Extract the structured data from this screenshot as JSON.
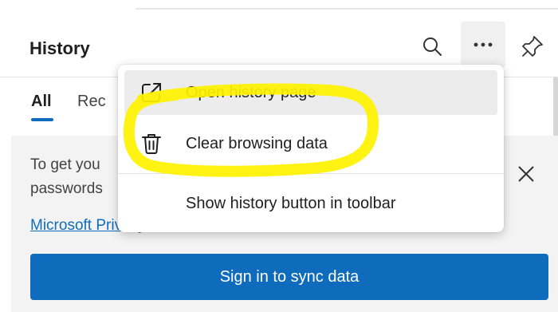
{
  "panel": {
    "title": "History",
    "tabs": [
      {
        "label": "All",
        "selected": true
      },
      {
        "label": "Rec",
        "selected": false
      }
    ]
  },
  "header_icons": [
    "search-icon",
    "more-icon",
    "pin-icon"
  ],
  "banner": {
    "text_line1": "To get you",
    "text_line2": "passwords",
    "privacy_link": "Microsoft Privacy Statement",
    "sync_button": "Sign in to sync data"
  },
  "menu": {
    "items": [
      {
        "label": "Open history page",
        "icon": "open-external-icon",
        "hovered": true
      },
      {
        "label": "Clear browsing data",
        "icon": "trash-icon",
        "hovered": false
      },
      {
        "label": "Show history button in toolbar",
        "icon": "",
        "hovered": false
      }
    ]
  },
  "annotation": {
    "highlight_color": "#fff200"
  },
  "colors": {
    "accent": "#0f6cbd",
    "banner_bg": "#f3f3f3"
  }
}
